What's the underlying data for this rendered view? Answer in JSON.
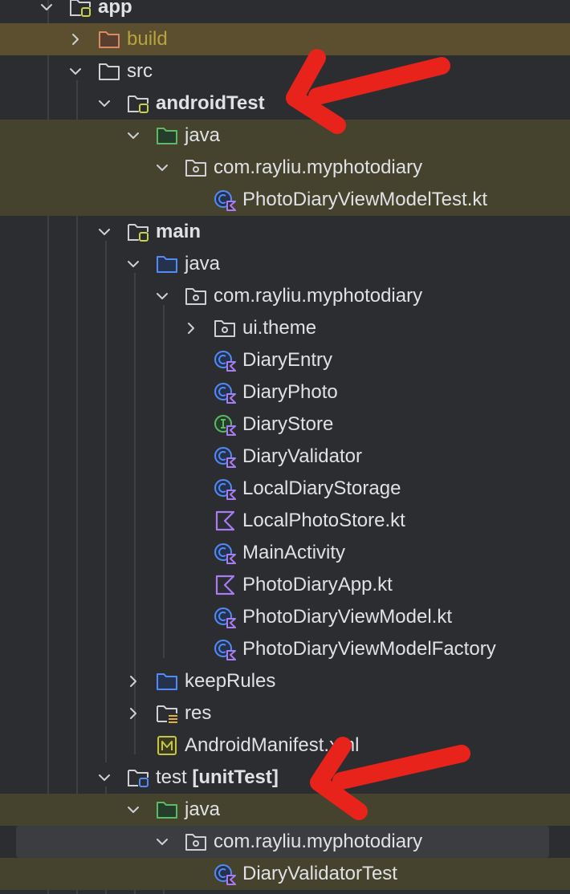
{
  "colors": {
    "background": "#2b2d30",
    "highlight_row": "#45422d",
    "build_row": "#5b4f30",
    "selected_row": "#3b3d41",
    "text": "#dfe1e5",
    "build_text": "#b8a43a",
    "arrow": "#e8231b",
    "kotlin_purple": "#a97cf6",
    "class_blue": "#548af7",
    "interface_green": "#5fb865"
  },
  "tree": {
    "items": [
      {
        "label": "app",
        "bold": true,
        "icon": "module-folder-icon",
        "chevron": "chevron-down-icon"
      },
      {
        "label": "build",
        "icon": "excluded-folder-icon",
        "chevron": "chevron-right-icon"
      },
      {
        "label": "src",
        "icon": "folder-icon",
        "chevron": "chevron-down-icon"
      },
      {
        "label": "androidTest",
        "bold": true,
        "icon": "module-folder-icon",
        "chevron": "chevron-down-icon"
      },
      {
        "label": "java",
        "icon": "test-source-folder-icon",
        "chevron": "chevron-down-icon"
      },
      {
        "label": "com.rayliu.myphotodiary",
        "icon": "package-icon",
        "chevron": "chevron-down-icon"
      },
      {
        "label": "PhotoDiaryViewModelTest.kt",
        "icon": "kotlin-class-icon"
      },
      {
        "label": "main",
        "bold": true,
        "icon": "module-folder-icon",
        "chevron": "chevron-down-icon"
      },
      {
        "label": "java",
        "icon": "source-folder-icon",
        "chevron": "chevron-down-icon"
      },
      {
        "label": "com.rayliu.myphotodiary",
        "icon": "package-icon",
        "chevron": "chevron-down-icon"
      },
      {
        "label": "ui.theme",
        "icon": "package-icon",
        "chevron": "chevron-right-icon"
      },
      {
        "label": "DiaryEntry",
        "icon": "kotlin-class-icon"
      },
      {
        "label": "DiaryPhoto",
        "icon": "kotlin-class-icon"
      },
      {
        "label": "DiaryStore",
        "icon": "kotlin-interface-icon"
      },
      {
        "label": "DiaryValidator",
        "icon": "kotlin-class-icon"
      },
      {
        "label": "LocalDiaryStorage",
        "icon": "kotlin-class-icon"
      },
      {
        "label": "LocalPhotoStore.kt",
        "icon": "kotlin-file-icon"
      },
      {
        "label": "MainActivity",
        "icon": "kotlin-class-icon"
      },
      {
        "label": "PhotoDiaryApp.kt",
        "icon": "kotlin-file-icon"
      },
      {
        "label": "PhotoDiaryViewModel.kt",
        "icon": "kotlin-class-icon"
      },
      {
        "label": "PhotoDiaryViewModelFactory",
        "icon": "kotlin-class-icon"
      },
      {
        "label": "keepRules",
        "icon": "source-folder-icon",
        "chevron": "chevron-right-icon"
      },
      {
        "label": "res",
        "icon": "resources-folder-icon",
        "chevron": "chevron-right-icon"
      },
      {
        "label": "AndroidManifest.xml",
        "icon": "manifest-icon"
      },
      {
        "label": "test",
        "tag": "[unitTest]",
        "icon": "unit-test-module-icon",
        "chevron": "chevron-down-icon"
      },
      {
        "label": "java",
        "icon": "test-source-folder-icon",
        "chevron": "chevron-down-icon"
      },
      {
        "label": "com.rayliu.myphotodiary",
        "icon": "package-icon",
        "chevron": "chevron-down-icon"
      },
      {
        "label": "DiaryValidatorTest",
        "icon": "kotlin-class-icon"
      }
    ]
  }
}
